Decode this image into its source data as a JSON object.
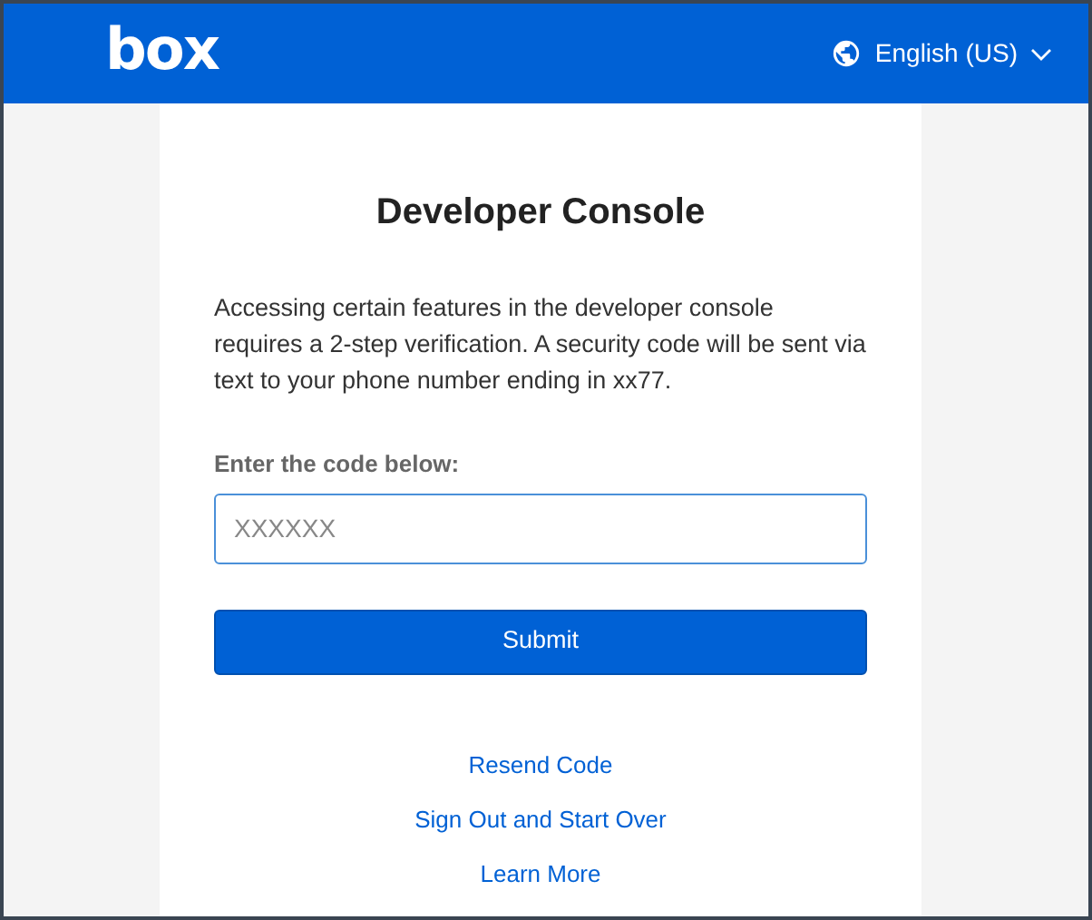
{
  "header": {
    "logo": "box",
    "language": "English (US)"
  },
  "card": {
    "title": "Developer Console",
    "message": "Accessing certain features in the developer console requires a 2-step verification. A security code will be sent via text to your phone number ending in xx77.",
    "code_field": {
      "label": "Enter the code below:",
      "placeholder": "XXXXXX"
    },
    "submit": "Submit",
    "links": [
      "Resend Code",
      "Sign Out and Start Over",
      "Learn More"
    ]
  }
}
